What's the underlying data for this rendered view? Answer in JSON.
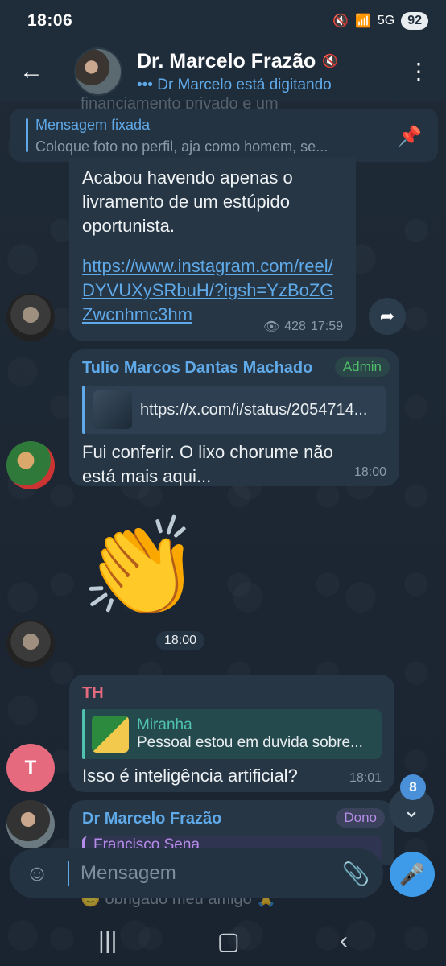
{
  "status_bar": {
    "time": "18:06",
    "signal": "5G",
    "battery": "92"
  },
  "header": {
    "name": "Dr. Marcelo Frazão",
    "status": "••• Dr Marcelo está digitando"
  },
  "pinned": {
    "title": "Mensagem fixada",
    "text": "Coloque foto no perfil,  aja como homem,  se..."
  },
  "ghost_line": "financiamento privado e um",
  "messages": [
    {
      "text": "Acabou havendo apenas o livramento de um estúpido oportunista.",
      "link": "https://www.instagram.com/reel/DYVUXySRbuH/?igsh=YzBoZGZwcnhmc3hm",
      "views": "428",
      "time": "17:59"
    },
    {
      "sender": "Tulio Marcos Dantas Machado",
      "tag": "Admin",
      "preview_url": "https://x.com/i/status/2054714...",
      "text": "Fui conferir. O lixo chorume não está mais aqui...",
      "time": "18:00"
    },
    {
      "sticker": "👏",
      "time": "18:00"
    },
    {
      "sender": "TH",
      "avatar_letter": "T",
      "reply_name": "Miranha",
      "reply_text": "Pessoal estou em duvida sobre...",
      "text": "Isso é inteligência artificial?",
      "time": "18:01"
    },
    {
      "sender": "Dr Marcelo Frazão",
      "tag": "Dono",
      "reply_name": "Francisco Sena"
    }
  ],
  "scroll": {
    "unread": "8"
  },
  "composer": {
    "placeholder": "Mensagem"
  },
  "under_text": "🙂 obrigado meu amigo 🙏",
  "colors": {
    "accent": "#5fa9e8",
    "bubble": "#263645",
    "admin": "#4fbf6a",
    "owner": "#b78be8"
  }
}
